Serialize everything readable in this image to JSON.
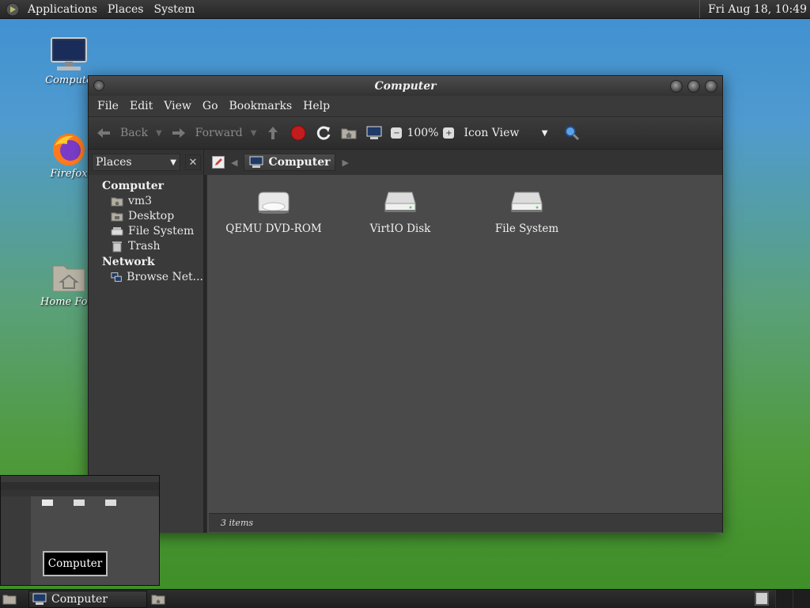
{
  "top_panel": {
    "menus": [
      "Applications",
      "Places",
      "System"
    ],
    "clock": "Fri Aug 18, 10:49"
  },
  "desktop": {
    "icons": [
      {
        "label": "Compute",
        "icon": "computer-icon"
      },
      {
        "label": "Firefox",
        "icon": "firefox-icon"
      },
      {
        "label": "Home Fold",
        "icon": "home-folder-icon"
      }
    ]
  },
  "window": {
    "title": "Computer",
    "menu": [
      "File",
      "Edit",
      "View",
      "Go",
      "Bookmarks",
      "Help"
    ],
    "toolbar": {
      "back": "Back",
      "forward": "Forward",
      "zoom": "100%",
      "view_mode": "Icon View"
    },
    "sidebar_selector": "Places",
    "breadcrumb": "Computer",
    "sidebar": {
      "sections": [
        {
          "title": "Computer",
          "items": [
            {
              "label": "vm3",
              "icon": "home-folder-icon"
            },
            {
              "label": "Desktop",
              "icon": "desktop-folder-icon"
            },
            {
              "label": "File System",
              "icon": "harddisk-icon"
            },
            {
              "label": "Trash",
              "icon": "trash-icon"
            }
          ]
        },
        {
          "title": "Network",
          "items": [
            {
              "label": "Browse Net...",
              "icon": "network-icon"
            }
          ]
        }
      ]
    },
    "files": [
      {
        "label": "QEMU DVD-ROM",
        "icon": "optical-drive-icon"
      },
      {
        "label": "VirtIO Disk",
        "icon": "harddisk-icon"
      },
      {
        "label": "File System",
        "icon": "harddisk-icon"
      }
    ],
    "status": "3 items"
  },
  "preview": {
    "title": "Computer"
  },
  "taskbar": {
    "task_label": "Computer"
  },
  "colors": {
    "desktop_top": "#3f8fd1",
    "desktop_bottom": "#3d8d26",
    "window_bg": "#3a3a3a",
    "content_bg": "#4a4a4a"
  }
}
